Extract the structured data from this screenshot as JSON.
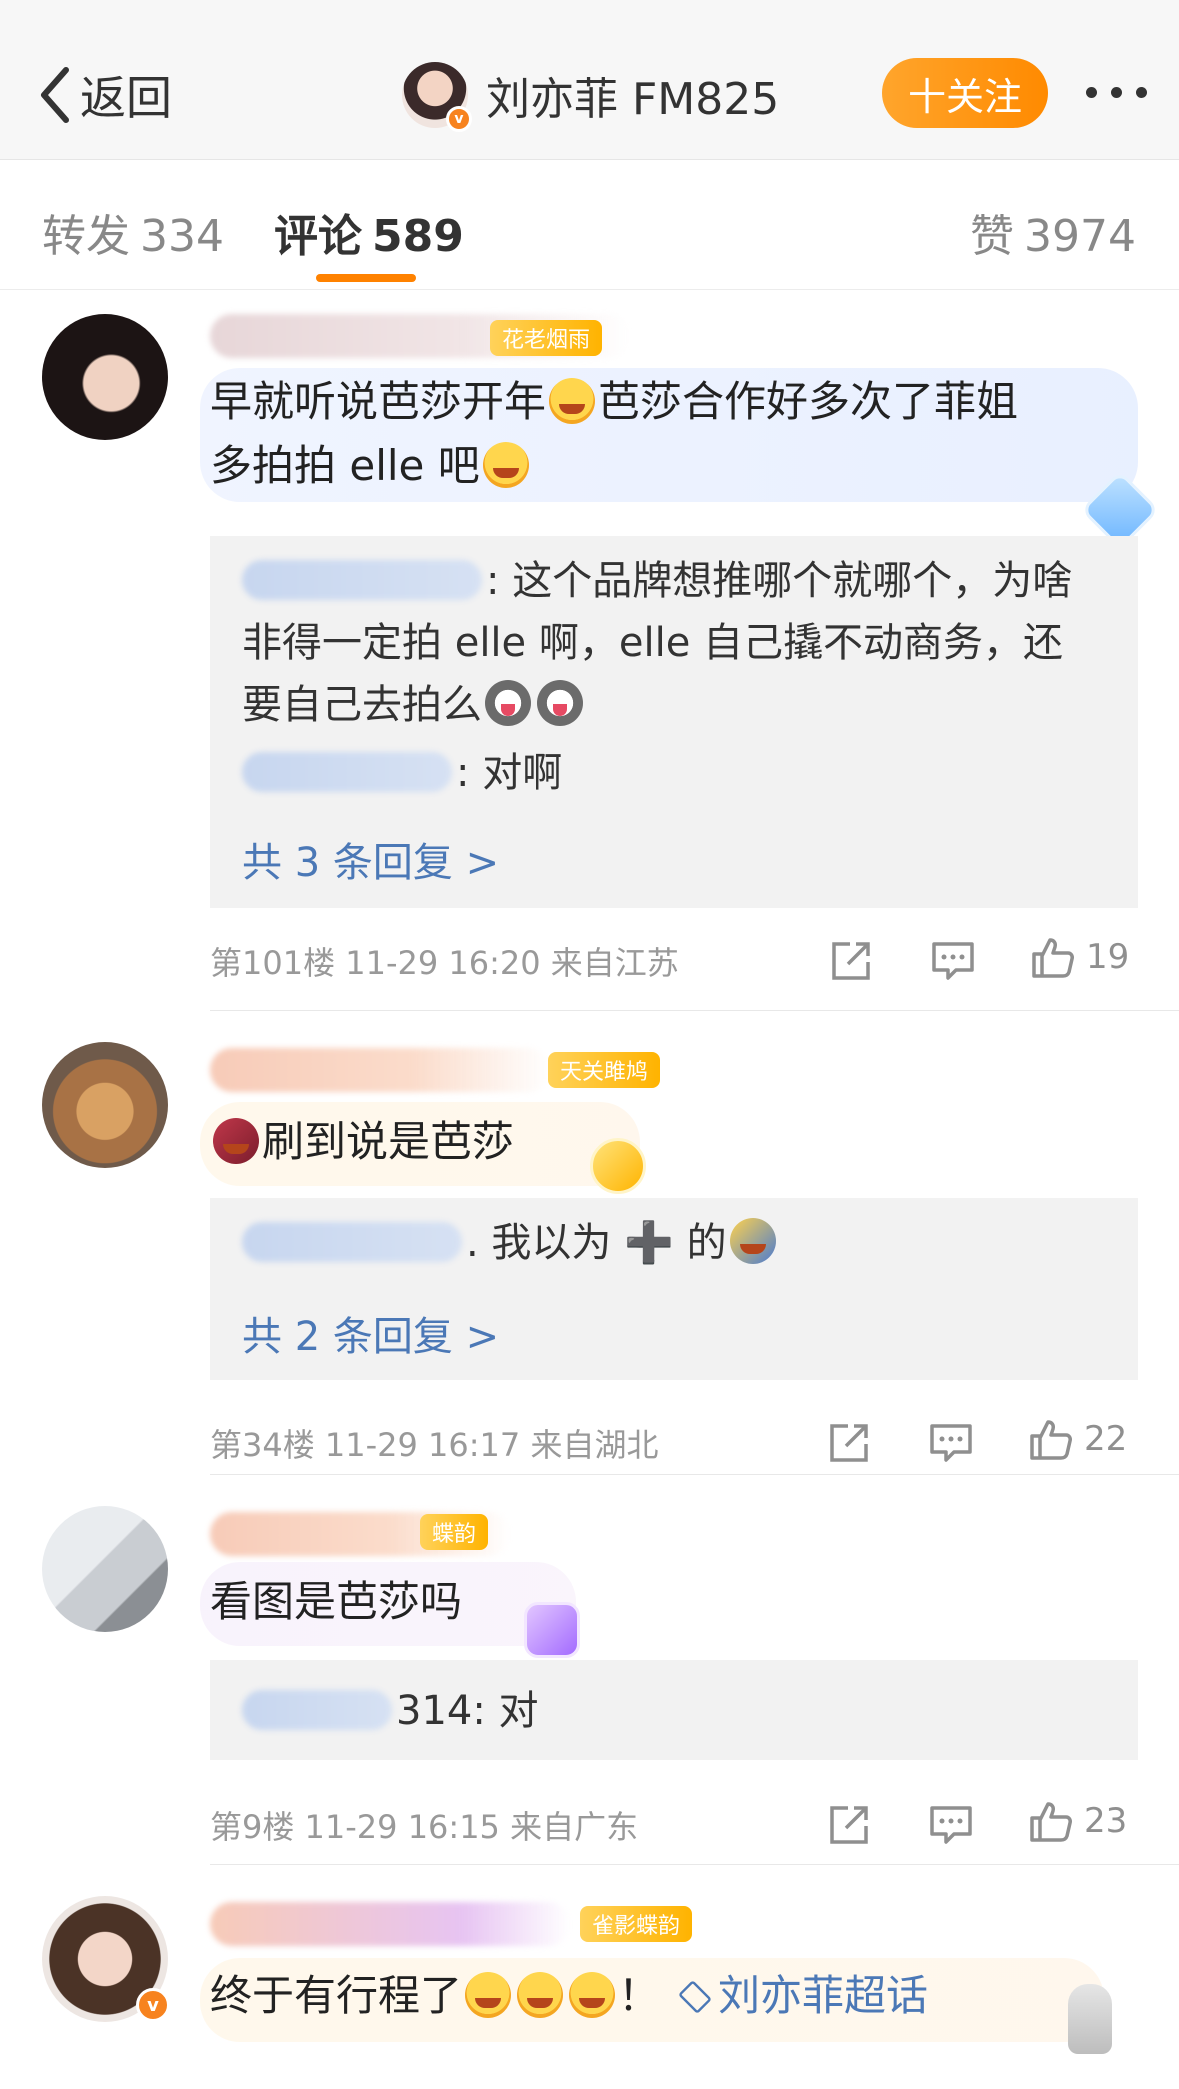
{
  "header": {
    "back_label": "返回",
    "account_name": "刘亦菲 FM825",
    "follow_label": "十关注"
  },
  "tabs": [
    {
      "label": "转发",
      "count": "334"
    },
    {
      "label": "评论",
      "count": "589"
    },
    {
      "label": "赞",
      "count": "3974"
    }
  ],
  "comments": [
    {
      "tag": "花老烟雨",
      "text_line1": "早就听说芭莎开年",
      "text_line1b": "芭莎合作好多次了菲姐",
      "text_line2": "多拍拍 elle 吧",
      "replies": [
        {
          "text": ": 这个品牌想推哪个就哪个，为啥"
        },
        {
          "text": "非得一定拍 elle 啊，elle 自己撬不动商务，还"
        },
        {
          "text": "要自己去拍么"
        },
        {
          "text": ": 对啊"
        }
      ],
      "reply_link": "共 3 条回复 >",
      "meta": "第101楼 11-29 16:20 来自江苏",
      "likes": "19"
    },
    {
      "tag": "天关雎鸠",
      "text": "刷到说是芭莎",
      "replies": [
        {
          "text": ". 我以为 ➕ 的"
        }
      ],
      "reply_link": "共 2 条回复 >",
      "meta": "第34楼 11-29 16:17 来自湖北",
      "likes": "22"
    },
    {
      "tag": "蝶韵",
      "text": "看图是芭莎吗",
      "replies": [
        {
          "text": "314: 对"
        }
      ],
      "meta": "第9楼 11-29 16:15 来自广东",
      "likes": "23"
    },
    {
      "tag": "雀影蝶韵",
      "text": "终于有行程了",
      "text_tail": "！",
      "topic": "刘亦菲超话"
    }
  ],
  "icons": {
    "back": "chevron-left-icon",
    "more": "more-dots-icon",
    "share": "share-icon",
    "comment": "comment-icon",
    "like": "thumbs-up-icon"
  },
  "colors": {
    "accent": "#ff8200",
    "link": "#4b78b6",
    "verified": "#f7831f"
  }
}
